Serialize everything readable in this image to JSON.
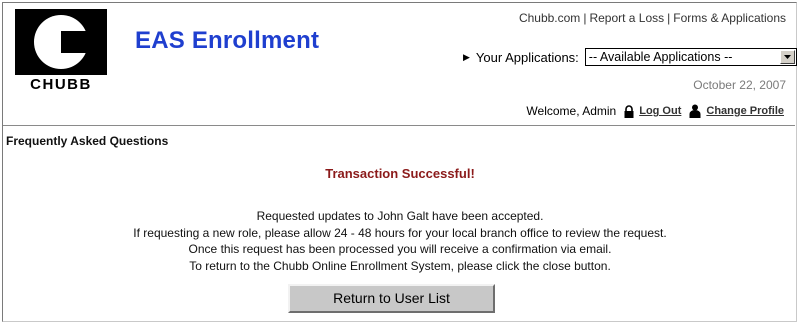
{
  "brand": {
    "logo_text": "CHUBB"
  },
  "header": {
    "app_title": "EAS Enrollment",
    "links": [
      "Chubb.com",
      "Report a Loss",
      "Forms & Applications"
    ],
    "apps_label": "Your Applications:",
    "apps_select_value": "-- Available Applications --",
    "date": "October 22, 2007",
    "welcome": "Welcome, Admin",
    "logout_label": "Log Out",
    "change_profile_label": "Change Profile"
  },
  "main": {
    "section_title": "Frequently Asked Questions",
    "status_message": "Transaction Successful!",
    "body_lines": [
      "Requested updates to John  Galt have been accepted.",
      "If requesting a new role, please allow 24 - 48 hours for your local branch office to review the request.",
      "Once this request has been processed you will receive a confirmation via email.",
      "To return to the Chubb Online Enrollment System, please click the close button."
    ],
    "return_button_label": "Return to User List"
  },
  "colors": {
    "title_blue": "#1f3fcf",
    "success_red": "#8b1a1a",
    "button_gray": "#c8c8c8"
  }
}
